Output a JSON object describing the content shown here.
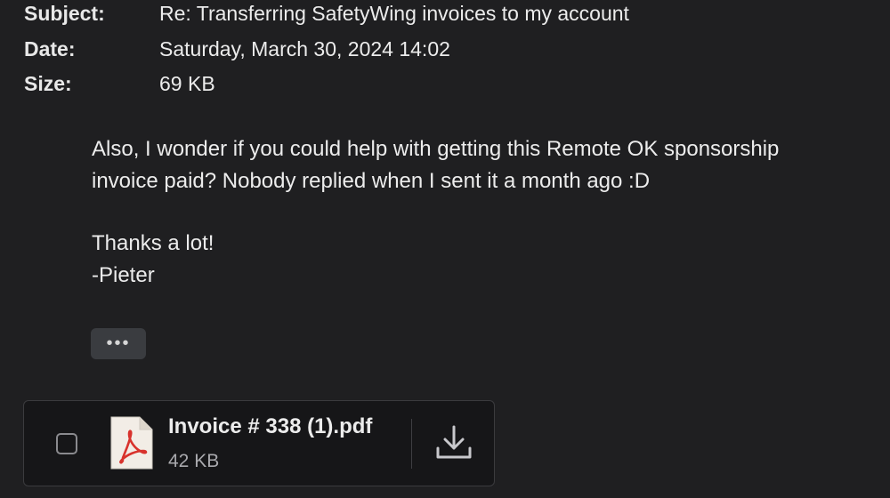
{
  "header": {
    "subject_label": "Subject:",
    "subject_value": "Re: Transferring SafetyWing invoices to my account",
    "date_label": "Date:",
    "date_value": "Saturday, March 30, 2024 14:02",
    "size_label": "Size:",
    "size_value": "69 KB"
  },
  "body": {
    "paragraph_1_line_1": "Also, I wonder if you could help with getting this Remote OK sponsorship",
    "paragraph_1_line_2": "invoice paid? Nobody replied when I sent it a month ago :D",
    "thanks_line": "Thanks a lot!",
    "signature": "-Pieter"
  },
  "more_button": {
    "label": "•••"
  },
  "attachment": {
    "file_name": "Invoice # 338 (1).pdf",
    "file_size": "42 KB",
    "icon": "pdf-icon",
    "download_icon": "download-icon",
    "checked": false
  },
  "colors": {
    "background": "#1f1f21",
    "attachment_background": "#161618",
    "pdf_red": "#d8322c"
  }
}
